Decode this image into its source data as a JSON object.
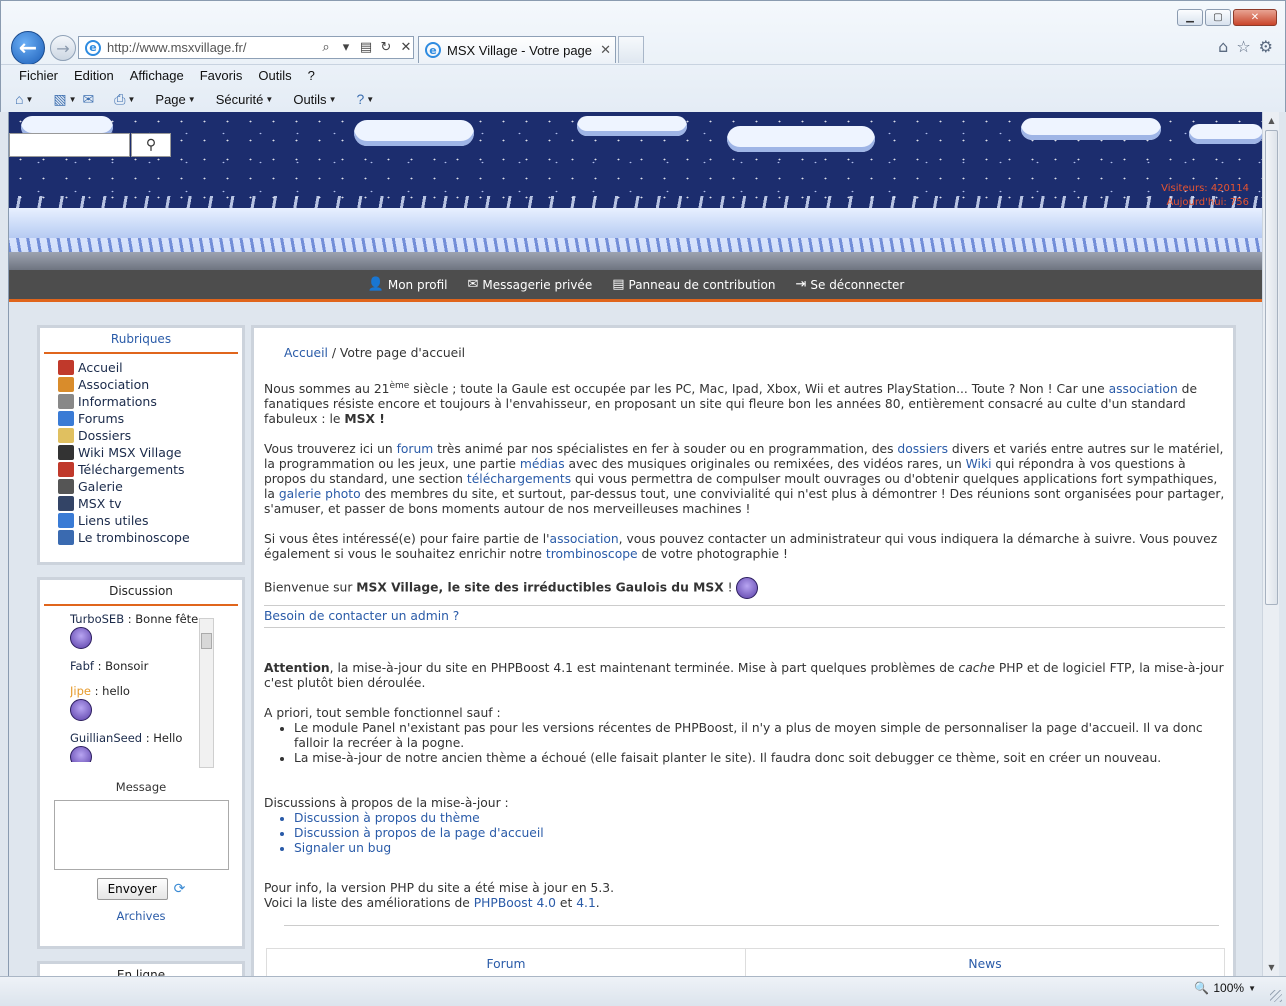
{
  "browser": {
    "address": "http://www.msxvillage.fr/",
    "tab_title": "MSX Village - Votre page d'...",
    "menu": [
      "Fichier",
      "Edition",
      "Affichage",
      "Favoris",
      "Outils",
      "?"
    ],
    "commands": {
      "page": "Page",
      "security": "Sécurité",
      "tools": "Outils"
    },
    "zoom": "100%"
  },
  "header": {
    "visitors_label": "Visiteurs: 420114",
    "today_label": "Aujourd'hui: 756"
  },
  "topnav": {
    "profile": "Mon profil",
    "messages": "Messagerie privée",
    "contribution": "Panneau de contribution",
    "logout": "Se déconnecter"
  },
  "rubriques": {
    "title": "Rubriques",
    "items": [
      {
        "label": "Accueil",
        "icon": "home-icon",
        "color": "#c0392b"
      },
      {
        "label": "Association",
        "icon": "people-icon",
        "color": "#d98c2b"
      },
      {
        "label": "Informations",
        "icon": "info-icon",
        "color": "#888888"
      },
      {
        "label": "Forums",
        "icon": "forum-icon",
        "color": "#3a7bd5"
      },
      {
        "label": "Dossiers",
        "icon": "folder-icon",
        "color": "#e0c060"
      },
      {
        "label": "Wiki MSX Village",
        "icon": "wiki-icon",
        "color": "#333333"
      },
      {
        "label": "Téléchargements",
        "icon": "download-icon",
        "color": "#c0392b"
      },
      {
        "label": "Galerie",
        "icon": "brush-icon",
        "color": "#555555"
      },
      {
        "label": "MSX tv",
        "icon": "tv-icon",
        "color": "#334466"
      },
      {
        "label": "Liens utiles",
        "icon": "globe-icon",
        "color": "#3a7bd5"
      },
      {
        "label": "Le trombinoscope",
        "icon": "user-icon",
        "color": "#3a6ab0"
      }
    ]
  },
  "discussion": {
    "title": "Discussion",
    "messages": [
      {
        "user": "TurboSEB",
        "text": "Bonne fête",
        "smiley": true
      },
      {
        "user": "Fabf",
        "text": "Bonsoir",
        "smiley": false
      },
      {
        "user": "Jipe",
        "text": "hello",
        "smiley": true
      },
      {
        "user": "GuillianSeed",
        "text": "Hello",
        "smiley": true
      }
    ],
    "message_label": "Message",
    "send_label": "Envoyer",
    "archives_label": "Archives",
    "next_box_title": "En ligne"
  },
  "main": {
    "breadcrumb_home": "Accueil",
    "breadcrumb_sep": "/",
    "breadcrumb_current": "Votre page d'accueil",
    "p1_a": "Nous sommes au 21",
    "p1_sup": "ème",
    "p1_b": " siècle ; toute la Gaule est occupée par les PC, Mac, Ipad, Xbox, Wii et autres PlayStation... Toute ? Non ! Car une ",
    "p1_link": "association",
    "p1_c": " de fanatiques résiste encore et toujours à l'envahisseur, en proposant un site qui fleure bon les années 80, entièrement consacré au culte d'un standard fabuleux : le ",
    "p1_msx": "MSX",
    "p1_end": " !",
    "p2_a": "Vous trouverez ici un ",
    "p2_forum": "forum",
    "p2_b": " très animé par nos spécialistes en fer à souder ou en programmation, des ",
    "p2_dossiers": "dossiers",
    "p2_c": " divers et variés entre autres sur le matériel, la programmation ou les jeux, une partie ",
    "p2_medias": "médias",
    "p2_d": " avec des musiques originales ou remixées, des vidéos rares, un ",
    "p2_wiki": "Wiki",
    "p2_e": " qui répondra à vos questions à propos du standard, une section ",
    "p2_telech": "téléchargements",
    "p2_f": " qui vous permettra de compulser moult ouvrages ou d'obtenir quelques applications fort sympathiques, la ",
    "p2_galerie": "galerie photo",
    "p2_g": " des membres du site, et surtout, par-dessus tout, une convivialité qui n'est plus à démontrer ! Des réunions sont organisées pour partager, s'amuser, et passer de bons moments autour de nos merveilleuses machines !",
    "p3_a": "Si vous êtes intéressé(e) pour faire partie de l'",
    "p3_assoc": "association",
    "p3_b": ", vous pouvez contacter un administrateur qui vous indiquera la démarche à suivre. Vous pouvez également si vous le souhaitez enrichir notre ",
    "p3_tromb": "trombinoscope",
    "p3_c": " de votre photographie !",
    "p4_a": "Bienvenue sur ",
    "p4_bold": "MSX Village, le site des irréductibles Gaulois du MSX",
    "p4_end": " !",
    "contact": "Besoin de contacter un admin ?",
    "attention_bold": "Attention",
    "attention_a": ", la mise-à-jour du site en PHPBoost 4.1 est maintenant terminée. Mise à part quelques problèmes de ",
    "attention_cache": "cache",
    "attention_b": " PHP et de logiciel FTP, la mise-à-jour c'est plutôt bien déroulée.",
    "apriori": "A priori, tout semble fonctionnel sauf :",
    "bullets": [
      "Le module Panel n'existant pas pour les versions récentes de PHPBoost, il n'y a plus de moyen simple de personnaliser la page d'accueil. Il va donc falloir la recréer à la pogne.",
      "La mise-à-jour de notre ancien thème a échoué (elle faisait planter le site). Il faudra donc soit debugger ce thème, soit en créer un nouveau."
    ],
    "discussions_title": "Discussions à propos de la mise-à-jour :",
    "discussion_links": [
      "Discussion à propos du thème",
      "Discussion à propos de la page d'accueil",
      "Signaler un bug"
    ],
    "info_a": "Pour info, la version PHP du site a été mise à jour en 5.3.",
    "info_b": "Voici la liste des améliorations de ",
    "info_link1": "PHPBoost 4.0",
    "info_and": " et ",
    "info_link2": "4.1",
    "info_end": ".",
    "table_forum": "Forum",
    "table_news": "News"
  }
}
